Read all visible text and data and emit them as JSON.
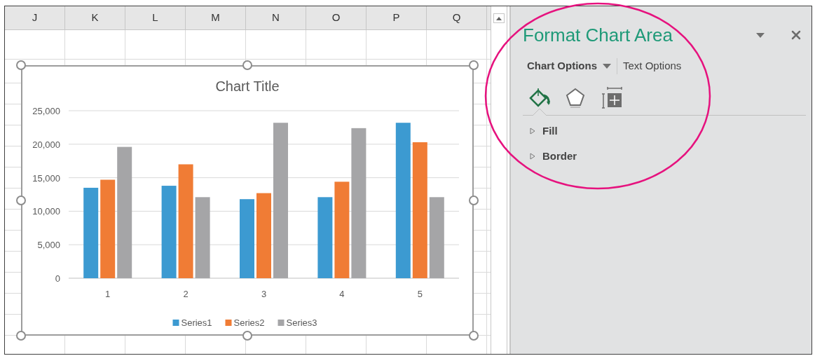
{
  "spreadsheet": {
    "columns": [
      "J",
      "K",
      "L",
      "M",
      "N",
      "O",
      "P",
      "Q"
    ]
  },
  "chart": {
    "selected": true,
    "chart_data": {
      "type": "bar",
      "title": "Chart Title",
      "grid": true,
      "legend": true,
      "categories": [
        "1",
        "2",
        "3",
        "4",
        "5"
      ],
      "ylim": [
        0,
        25000
      ],
      "yticks": [
        {
          "value": 0,
          "label": "0"
        },
        {
          "value": 5000,
          "label": "5,000"
        },
        {
          "value": 10000,
          "label": "10,000"
        },
        {
          "value": 15000,
          "label": "15,000"
        },
        {
          "value": 20000,
          "label": "20,000"
        },
        {
          "value": 25000,
          "label": "25,000"
        }
      ],
      "series": [
        {
          "name": "Series1",
          "color": "#3c9ad1",
          "values": [
            13500,
            13800,
            11800,
            12100,
            23200
          ]
        },
        {
          "name": "Series2",
          "color": "#f07c35",
          "values": [
            14700,
            17000,
            12700,
            14400,
            20300
          ]
        },
        {
          "name": "Series3",
          "color": "#a5a5a7",
          "values": [
            19600,
            12100,
            23200,
            22400,
            12100
          ]
        }
      ]
    }
  },
  "panel": {
    "title": "Format Chart Area",
    "tabs": [
      {
        "label": "Chart Options",
        "selected": true,
        "has_menu": true
      },
      {
        "label": "Text Options",
        "selected": false,
        "has_menu": false
      }
    ],
    "icon_tabs": [
      {
        "kind": "fill",
        "selected": true
      },
      {
        "kind": "effects",
        "selected": false
      },
      {
        "kind": "size",
        "selected": false
      }
    ],
    "sections": [
      {
        "label": "Fill",
        "expanded": false
      },
      {
        "label": "Border",
        "expanded": false
      }
    ]
  }
}
